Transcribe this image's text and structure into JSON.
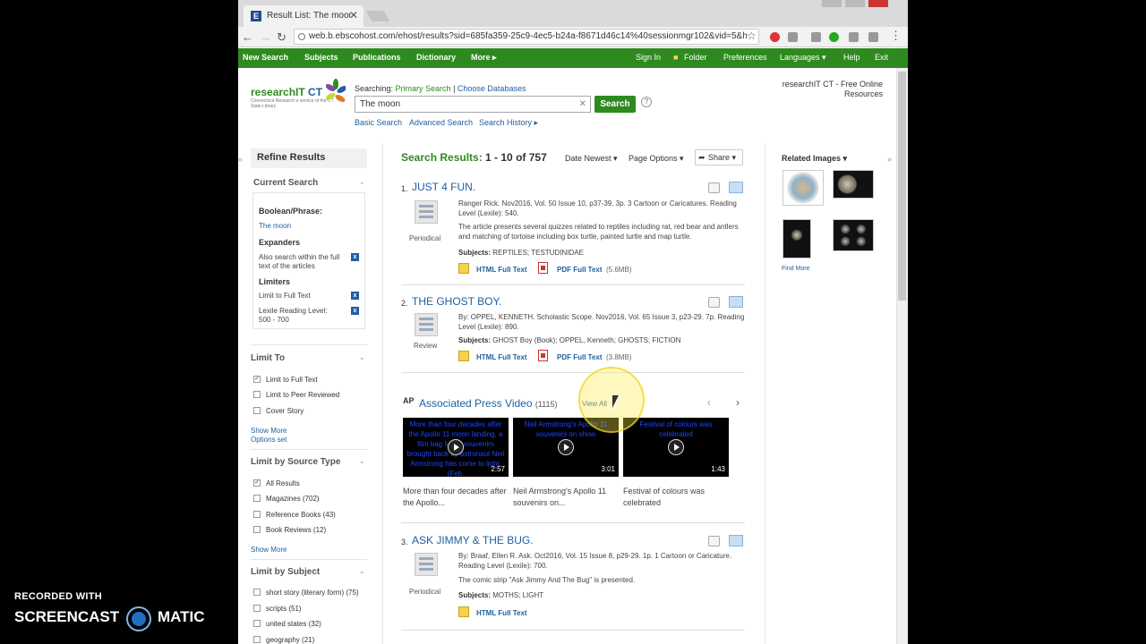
{
  "browser": {
    "tab_title": "Result List: The moon: EB",
    "tab_favicon": "E",
    "url": "web.b.ebscohost.com/ehost/results?sid=685fa359-25c9-4ec5-b24a-f8671d46c14%40sessionmgr102&vid=5&h"
  },
  "topnav": {
    "left": [
      "New Search",
      "Subjects",
      "Publications",
      "Dictionary",
      "More ▸"
    ],
    "right": [
      "Sign In",
      "Folder",
      "Preferences",
      "Languages ▾",
      "Help",
      "Exit"
    ]
  },
  "header": {
    "logo_main": "researchIT",
    "logo_ct": "CT",
    "logo_sub": "Connecticut Research a service of the CT State Library",
    "searching_label": "Searching:",
    "searching_db": "Primary Search",
    "choose_db": "Choose Databases",
    "query": "The moon",
    "search_button": "Search",
    "help_glyph": "?",
    "links": [
      "Basic Search",
      "Advanced Search",
      "Search History ▸"
    ],
    "account": "researchIT CT - Free Online Resources"
  },
  "sidebar": {
    "refine": "Refine Results",
    "current_search": "Current Search",
    "boolean_label": "Boolean/Phrase:",
    "boolean_value": "The moon",
    "expanders_label": "Expanders",
    "expander_item": "Also search within the full text of the articles",
    "limiters_label": "Limiters",
    "limiter_items": [
      "Limit to Full Text",
      "Lexile Reading Level: 500 - 700"
    ],
    "limit_to": "Limit To",
    "limit_to_items": [
      {
        "label": "Limit to Full Text",
        "checked": true
      },
      {
        "label": "Limit to Peer Reviewed",
        "checked": false
      },
      {
        "label": "Cover Story",
        "checked": false
      }
    ],
    "show_more": "Show More",
    "options_set": "Options set",
    "source_type": "Limit by Source Type",
    "source_items": [
      {
        "label": "All Results",
        "checked": true
      },
      {
        "label": "Magazines (702)",
        "checked": false
      },
      {
        "label": "Reference Books (43)",
        "checked": false
      },
      {
        "label": "Book Reviews (12)",
        "checked": false
      }
    ],
    "subject": "Limit by Subject",
    "subject_items": [
      {
        "label": "short story (literary form) (75)",
        "checked": false
      },
      {
        "label": "scripts (51)",
        "checked": false
      },
      {
        "label": "united states (32)",
        "checked": false
      },
      {
        "label": "geography (21)",
        "checked": false
      }
    ]
  },
  "results": {
    "heading": "Search Results:",
    "count": "1 - 10 of 757",
    "sort": "Date Newest ▾",
    "page_options": "Page Options ▾",
    "share": "Share ▾",
    "items": [
      {
        "num": "1.",
        "title": "JUST 4 FUN.",
        "type": "Periodical",
        "meta": "Ranger Rick. Nov2016, Vol. 50 Issue 10, p37-39. 3p. 3 Cartoon or Caricatures. Reading Level (Lexile): 540.",
        "abstract": "The article presents several quizzes related to reptiles including rat, red bear and antlers and matching of tortoise including box turtle, painted turtle and map turtle.",
        "subjects": "REPTILES; TESTUDINIDAE",
        "html": "HTML Full Text",
        "pdf": "PDF Full Text",
        "pdf_size": "(5.6MB)"
      },
      {
        "num": "2.",
        "title": "THE GHOST BOY.",
        "type": "Review",
        "meta": "By: OPPEL, KENNETH. Scholastic Scope. Nov2016, Vol. 65 Issue 3, p23-29. 7p. Reading Level (Lexile): 890.",
        "subjects": "GHOST Boy (Book); OPPEL, Kenneth; GHOSTS; FICTION",
        "html": "HTML Full Text",
        "pdf": "PDF Full Text",
        "pdf_size": "(3.8MB)"
      },
      {
        "num": "3.",
        "title": "ASK JIMMY & THE BUG.",
        "type": "Periodical",
        "meta": "By: Braaf, Ellen R. Ask. Oct2016, Vol. 15 Issue 8, p29-29. 1p. 1 Cartoon or Caricature. Reading Level (Lexile): 700.",
        "abstract": "The comic strip \"Ask Jimmy And The Bug\" is presented.",
        "subjects": "MOTHS; LIGHT",
        "html": "HTML Full Text"
      }
    ],
    "subjects_label": "Subjects:"
  },
  "ap": {
    "logo": "AP",
    "title": "Associated Press Video",
    "count": "(1115)",
    "view_all": "View All",
    "prev": "‹",
    "next": "›",
    "videos": [
      {
        "thumb_text": "More than four decades after the Apollo 11 moon landing, a film bag full of souvenirs brought back by astronaut Neil Armstrong has come to light. (Feb.",
        "duration": "2:57",
        "caption": "More than four decades after the Apollo..."
      },
      {
        "thumb_text": "Neil Armstrong's Apollo 11 souvenirs on show",
        "duration": "3:01",
        "caption": "Neil Armstrong's Apollo 11 souvenirs on..."
      },
      {
        "thumb_text": "Festival of colours was celebrated",
        "duration": "1:43",
        "caption": "Festival of colours was celebrated"
      }
    ]
  },
  "related": {
    "heading": "Related Images ▾",
    "find_more": "Find More"
  },
  "watermark": {
    "line1": "RECORDED WITH",
    "line2a": "SCREENCAST",
    "line2b": "MATIC"
  }
}
